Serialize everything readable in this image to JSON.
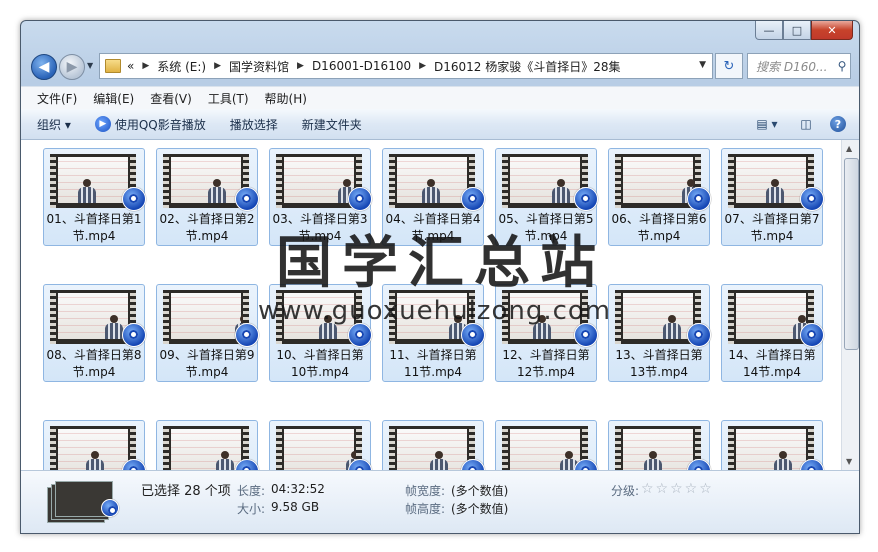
{
  "window": {
    "controls": {
      "minimize": "—",
      "maximize": "□",
      "close": "✕"
    }
  },
  "nav": {
    "back_icon": "◀",
    "forward_icon": "▶",
    "breadcrumb": [
      "系统 (E:)",
      "国学资料馆",
      "D16001-D16100",
      "D16012 杨家骏《斗首择日》28集"
    ],
    "breadcrumb_prefix": "«",
    "refresh_icon": "↻",
    "search_placeholder": "搜索 D160...",
    "search_icon": "⚲"
  },
  "menu": [
    "文件(F)",
    "编辑(E)",
    "查看(V)",
    "工具(T)",
    "帮助(H)"
  ],
  "toolbar": {
    "organize": "组织 ▾",
    "play_with_qq": "使用QQ影音播放",
    "play_selected": "播放选择",
    "new_folder": "新建文件夹",
    "view_icon": "▤ ▾",
    "pane_icon": "◫",
    "help_icon": "?"
  },
  "files": [
    "01、斗首择日第1节.mp4",
    "02、斗首择日第2节.mp4",
    "03、斗首择日第3节.mp4",
    "04、斗首择日第4节.mp4",
    "05、斗首择日第5节.mp4",
    "06、斗首择日第6节.mp4",
    "07、斗首择日第7节.mp4",
    "08、斗首择日第8节.mp4",
    "09、斗首择日第9节.mp4",
    "10、斗首择日第10节.mp4",
    "11、斗首择日第11节.mp4",
    "12、斗首择日第12节.mp4",
    "13、斗首择日第13节.mp4",
    "14、斗首择日第14节.mp4"
  ],
  "files_row3_count": 7,
  "watermark": {
    "title": "国学汇总站",
    "url": "www.guoxuehuizong.com"
  },
  "details": {
    "selected": "已选择 28 个项",
    "length_key": "长度:",
    "length_val": "04:32:52",
    "size_key": "大小:",
    "size_val": "9.58 GB",
    "width_key": "帧宽度:",
    "width_val": "(多个数值)",
    "height_key": "帧高度:",
    "height_val": "(多个数值)",
    "rating_key": "分级:",
    "rating_stars": "☆☆☆☆☆",
    "rating_value": 0
  }
}
